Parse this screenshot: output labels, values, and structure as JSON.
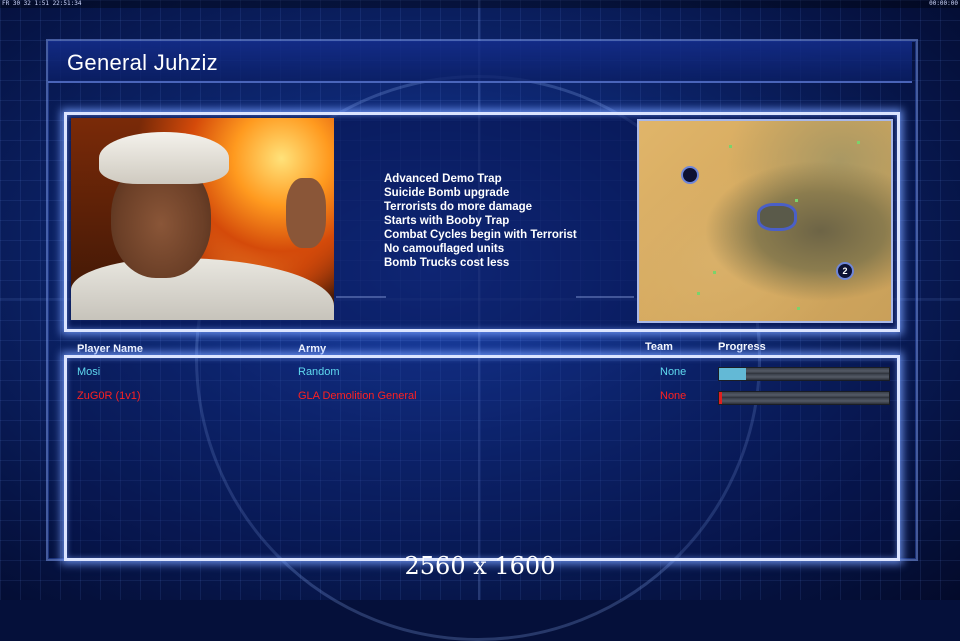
{
  "status_bar": {
    "left_text": "FR 30 32 1:51 22:51:34",
    "right_text": "00:00:00"
  },
  "header": {
    "title": "General Juhziz"
  },
  "general_traits": [
    "Advanced Demo Trap",
    "Suicide Bomb upgrade",
    "Terrorists do more damage",
    "Starts with Booby Trap",
    "Combat Cycles begin with Terrorist",
    "No camouflaged units",
    "Bomb Trucks cost less"
  ],
  "map": {
    "start_marker_2": "2"
  },
  "columns": {
    "player_name": "Player Name",
    "army": "Army",
    "team": "Team",
    "progress": "Progress"
  },
  "players": [
    {
      "name": "Mosi",
      "army": "Random",
      "team": "None",
      "progress": 0.16,
      "color": "#5fd9ef",
      "bar_color": "#63b9d6"
    },
    {
      "name": "ZuG0R (1v1)",
      "army": "GLA Demolition General",
      "team": "None",
      "progress": 0.02,
      "color": "#ff2020",
      "bar_color": "#e02020"
    }
  ],
  "overlay": {
    "resolution": "2560 x 1600"
  },
  "colors": {
    "panel_border": "#dbe4ff",
    "background": "#0d2670"
  }
}
